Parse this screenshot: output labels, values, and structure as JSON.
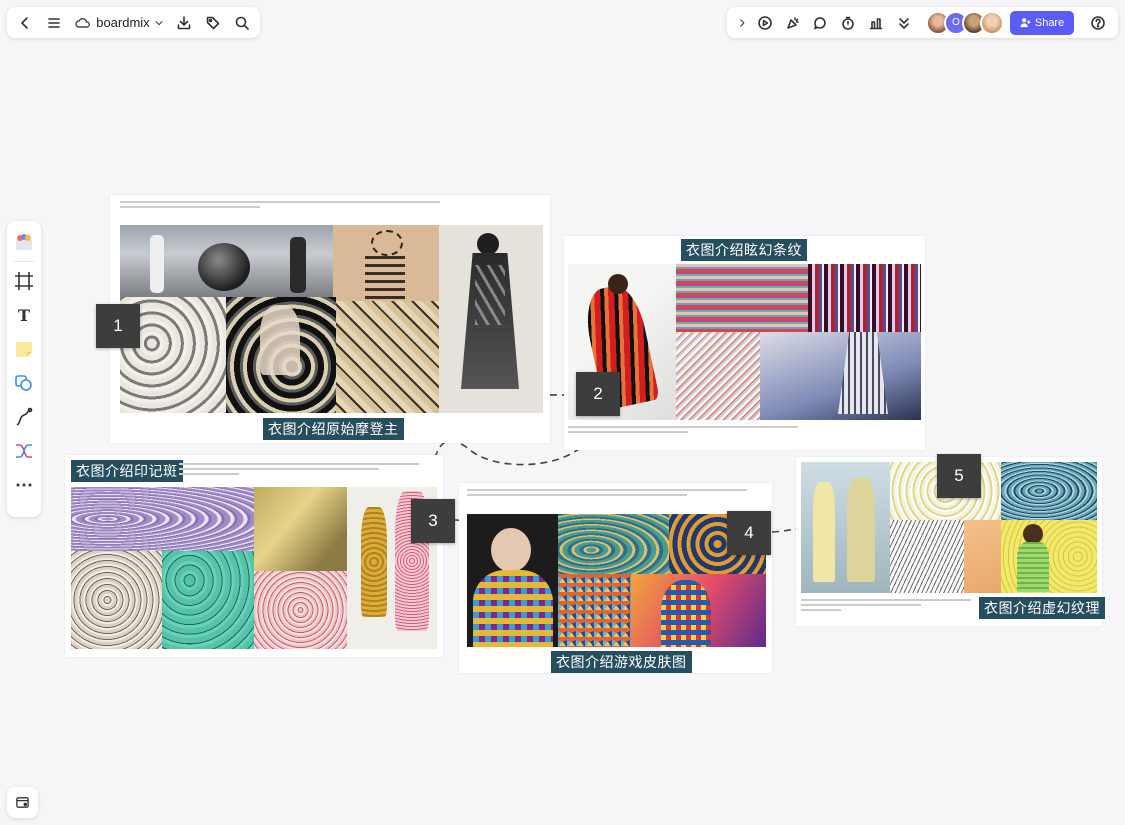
{
  "app": {
    "name": "boardmix"
  },
  "top_left_toolbar": {
    "back_icon": "chevron-left-icon",
    "menu_icon": "hamburger-icon",
    "brand_icon": "cloud-icon",
    "brand_name": "boardmix",
    "download_icon": "download-icon",
    "tag_icon": "tag-icon",
    "search_icon": "search-icon"
  },
  "top_right_toolbar": {
    "collaborator_initial": "O",
    "share_label": "Share",
    "help_icon": "help-icon"
  },
  "left_toolbar": {
    "tools": [
      "templates-icon",
      "frame-icon",
      "text-icon",
      "sticky-note-icon",
      "shape-icon",
      "pen-icon",
      "connector-icon",
      "more-icon"
    ]
  },
  "frames": [
    {
      "number": "1",
      "title": "衣图介绍原始摩登主"
    },
    {
      "number": "2",
      "title": "衣图介绍眩幻条纹"
    },
    {
      "number": "3",
      "title": "衣图介绍印记斑"
    },
    {
      "number": "4",
      "title": "衣图介绍游戏皮肤图"
    },
    {
      "number": "5",
      "title": "衣图介绍虚幻纹理"
    }
  ],
  "colors": {
    "accent": "#5b5bf5",
    "label_bg": "#264e5e",
    "number_bg": "#3d3d3d",
    "canvas_bg": "#f6f6f8"
  }
}
